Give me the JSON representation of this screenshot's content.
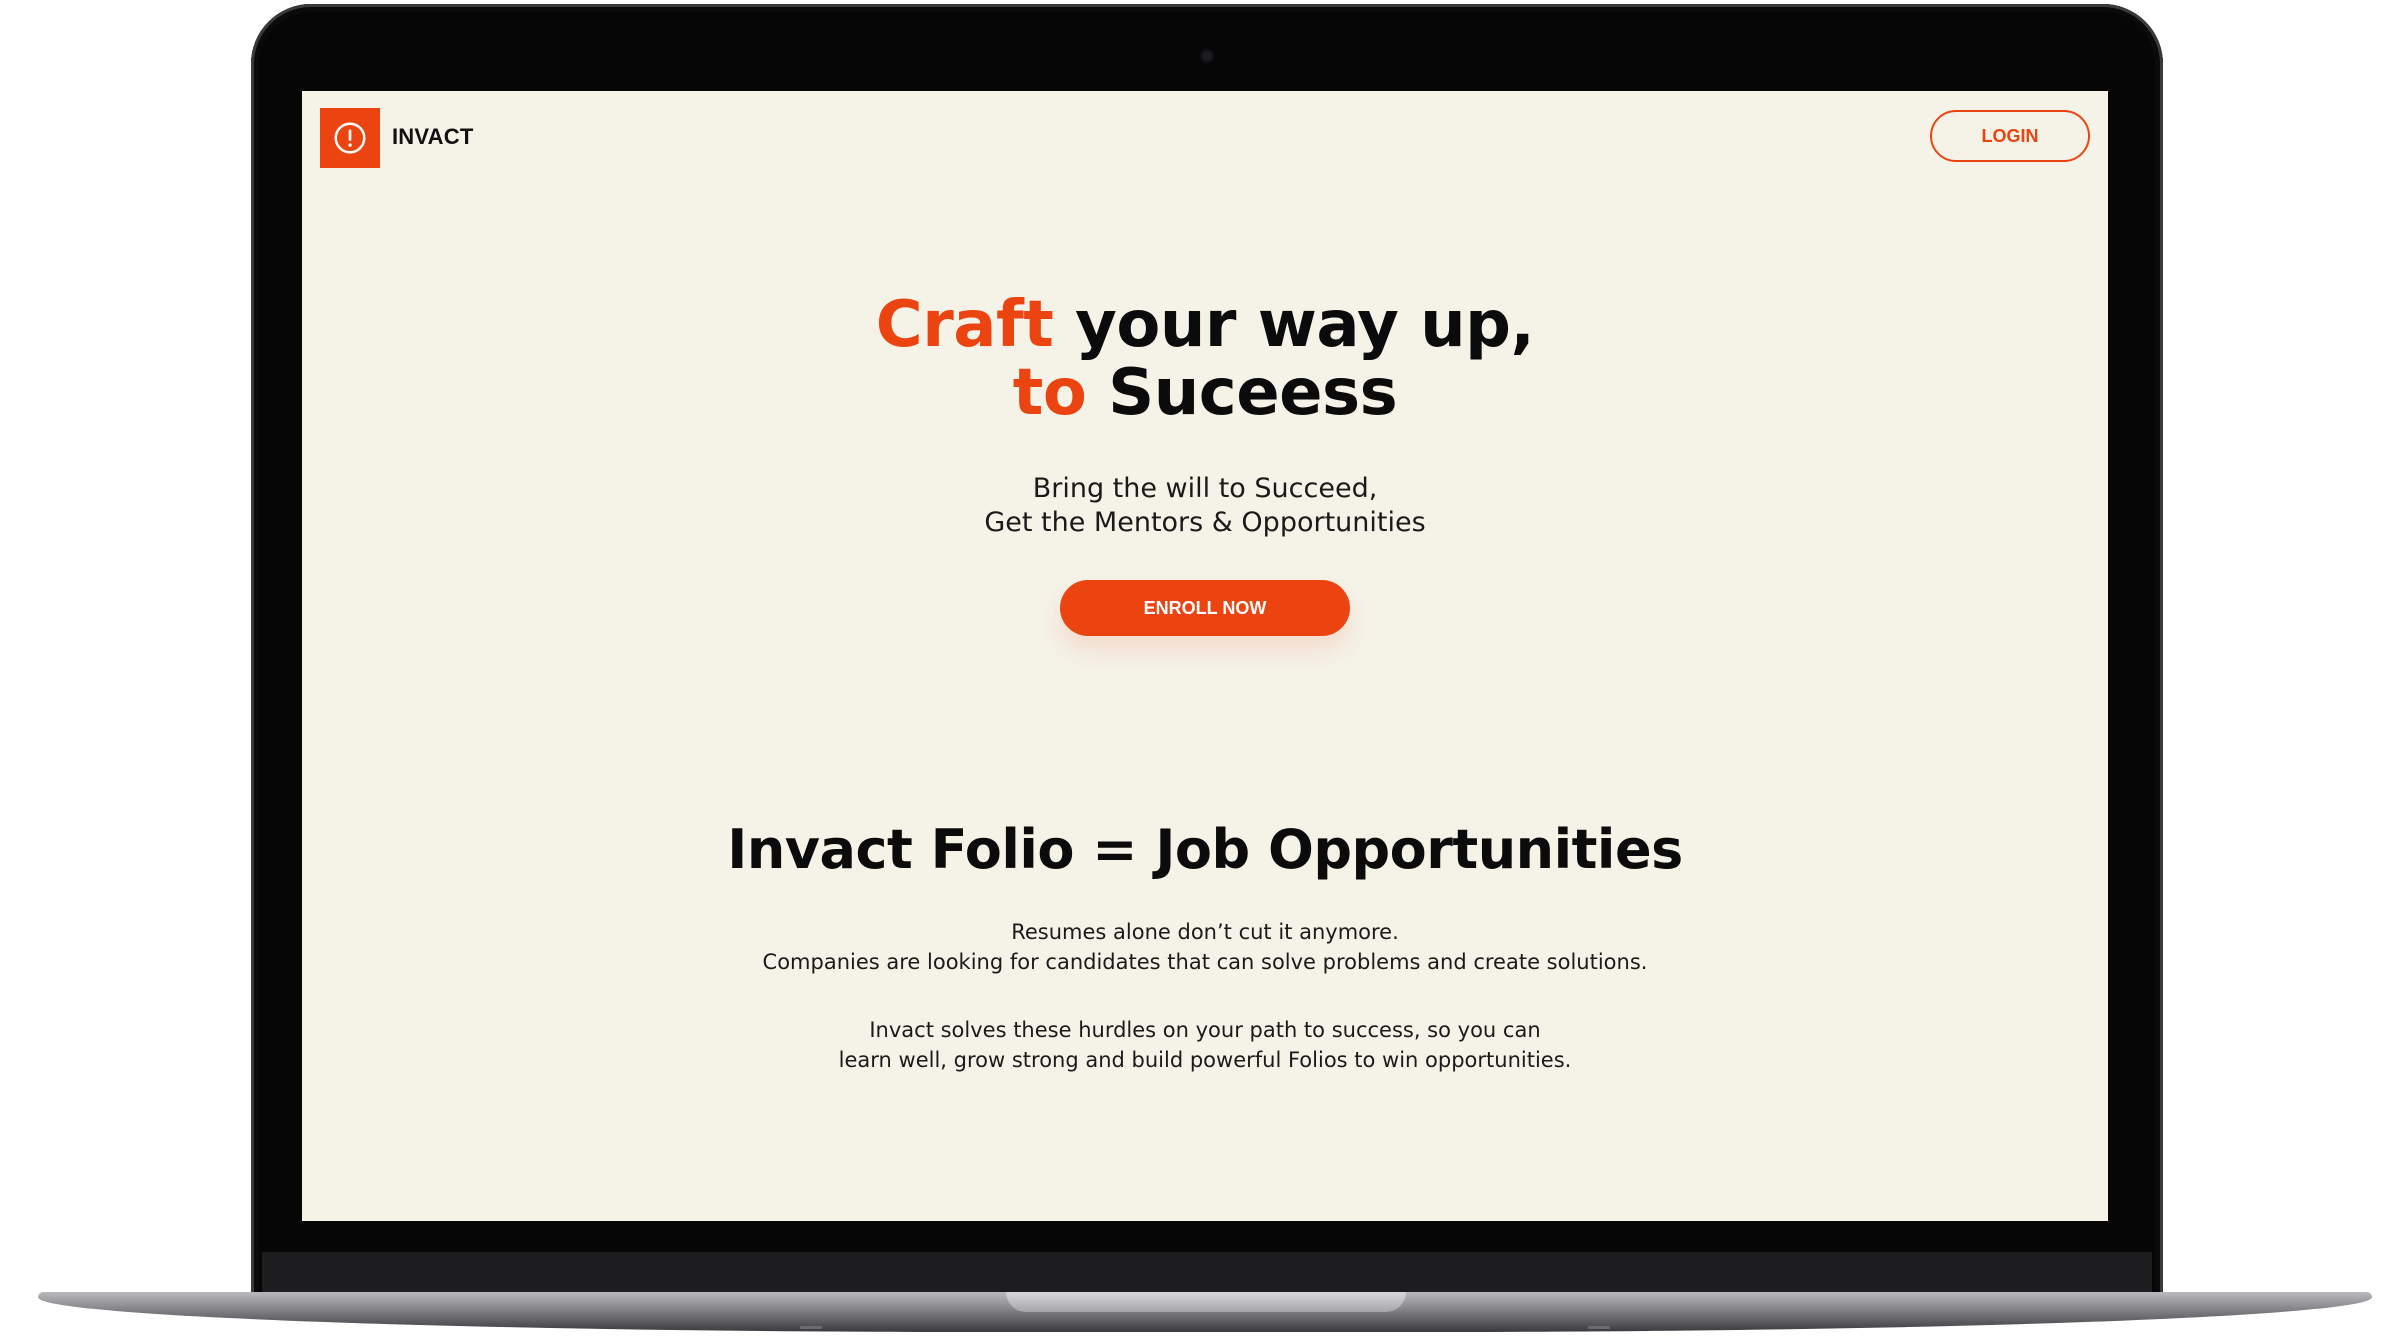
{
  "brand": {
    "name": "INVACT",
    "logo_icon": "exclamation-circle-icon",
    "accent_color": "#ec4410",
    "background_color": "#f5f2e8"
  },
  "header": {
    "login_label": "LOGIN"
  },
  "hero": {
    "title_word_1": "Craft",
    "title_rest_1": " your way up,",
    "title_word_2": "to",
    "title_rest_2": " Suceess",
    "subtitle_line_1": "Bring the will to Succeed,",
    "subtitle_line_2": "Get the Mentors & Opportunities",
    "cta_label": "ENROLL NOW"
  },
  "folio_section": {
    "title": "Invact Folio = Job Opportunities",
    "para1_line1": "Resumes alone don’t cut it anymore.",
    "para1_line2": "Companies are looking for candidates that can solve problems and create solutions.",
    "para2_line1": "Invact solves these hurdles on your path to success, so you can",
    "para2_line2": "learn well, grow strong and build powerful Folios to win opportunities."
  }
}
